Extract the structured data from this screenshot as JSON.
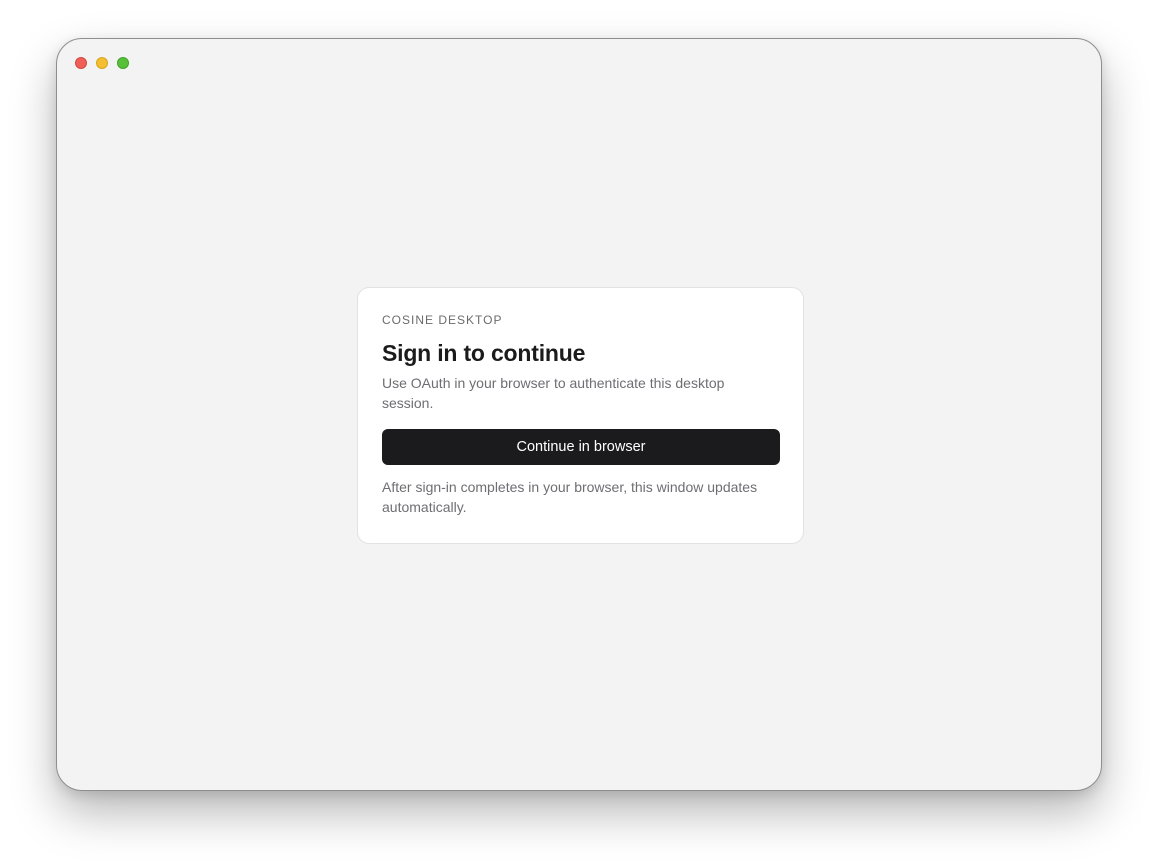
{
  "window": {
    "controls": [
      {
        "name": "close",
        "color": "#ee5f57"
      },
      {
        "name": "minimize",
        "color": "#f4bf2e"
      },
      {
        "name": "zoom",
        "color": "#57c038"
      }
    ]
  },
  "card": {
    "eyebrow": "COSINE DESKTOP",
    "title": "Sign in to continue",
    "description": "Use OAuth in your browser to authenticate this desktop session.",
    "button_label": "Continue in browser",
    "footnote": "After sign-in completes in your browser, this window updates automatically."
  },
  "colors": {
    "button_bg": "#1b1b1d",
    "window_bg": "#f3f3f3",
    "card_bg": "#ffffff"
  }
}
